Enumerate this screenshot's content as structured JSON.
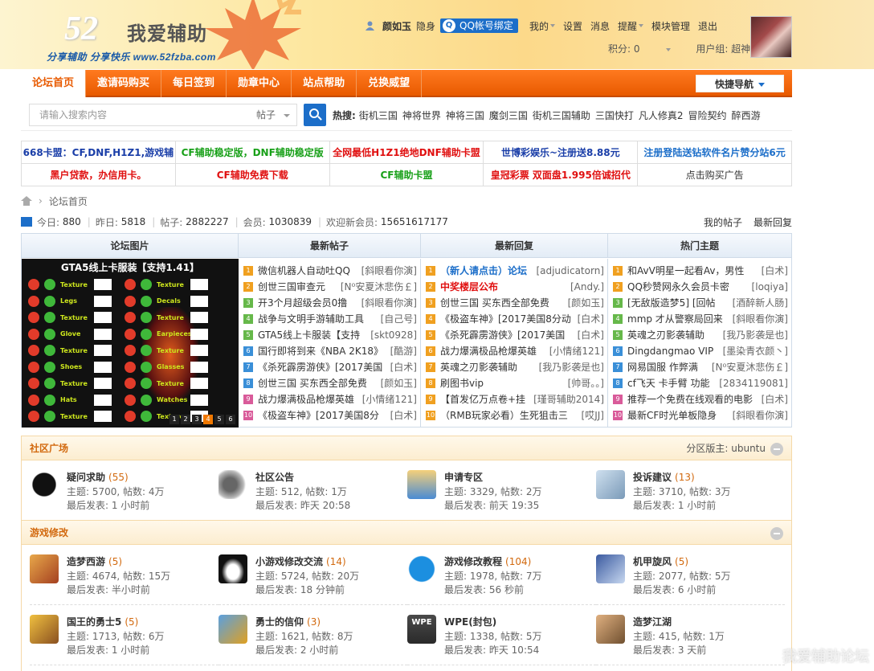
{
  "header": {
    "logo_num": "52",
    "logo_text": "我爱辅助",
    "slogan": "分享辅助  分享快乐  www.52fzba.com",
    "username": "颜如玉",
    "status": "隐身",
    "qq_bind": "QQ帐号绑定",
    "nav_links": [
      "我的",
      "设置",
      "消息",
      "提醒",
      "模块管理",
      "退出"
    ],
    "points": "积分: 0",
    "group": "用户组: 超神"
  },
  "main_nav": {
    "tabs": [
      "论坛首页",
      "邀请码购买",
      "每日签到",
      "勋章中心",
      "站点帮助",
      "兑换威望"
    ],
    "quick_nav": "快捷导航"
  },
  "search": {
    "placeholder": "请输入搜索内容",
    "type": "帖子",
    "hot_label": "热搜:",
    "hot_items": [
      "街机三国",
      "神将世界",
      "神将三国",
      "魔剑三国",
      "街机三国辅助",
      "三国快打",
      "凡人修真2",
      "冒险契约",
      "醉西游"
    ]
  },
  "ads": [
    [
      {
        "text": "668卡盟：CF,DNF,H1Z1,游戏辅",
        "color": "#1a3ea8"
      },
      {
        "text": "CF辅助稳定版，DNF辅助稳定版",
        "color": "#18a018"
      },
      {
        "text": "全网最低H1Z1绝地DNF辅助卡盟",
        "color": "#e01010"
      },
      {
        "text": "世博彩娱乐~注册送8.88元",
        "color": "#1a3ea8"
      },
      {
        "text": "注册登陆送钻软件名片赞分站6元",
        "color": "#1c6ec9"
      }
    ],
    [
      {
        "text": "黑户贷款，办信用卡。",
        "color": "#e01010"
      },
      {
        "text": "CF辅助免费下载",
        "color": "#e01010"
      },
      {
        "text": "CF辅助卡盟",
        "color": "#18a018"
      },
      {
        "text": "皇冠彩票 双面盘1.995倍诚招代",
        "color": "#e01010"
      },
      {
        "text": "点击购买广告",
        "color": "#333333"
      }
    ]
  ],
  "breadcrumb": {
    "item": "论坛首页"
  },
  "stats": {
    "today_label": "今日:",
    "today": "880",
    "yesterday_label": "昨日:",
    "yesterday": "5818",
    "posts_label": "帖子:",
    "posts": "2882227",
    "members_label": "会员:",
    "members": "1030839",
    "welcome_label": "欢迎新会员:",
    "newest": "15651617177",
    "my_posts": "我的帖子",
    "latest_reply": "最新回复"
  },
  "portal": {
    "headers": [
      "论坛图片",
      "最新帖子",
      "最新回复",
      "热门主题"
    ],
    "pic_caption": "GTA5线上卡服装【支持1.41】",
    "pic_labels": [
      "Texture",
      "Legs",
      "Texture",
      "Glove",
      "Texture",
      "Shoes",
      "Texture",
      "Hats",
      "Texture"
    ],
    "pic_labels2": [
      "Texture",
      "Decals",
      "Texture",
      "Earpieces",
      "Texture",
      "Glasses",
      "Texture",
      "Watches",
      "Texture"
    ],
    "pic_pages": [
      "1",
      "2",
      "3",
      "4",
      "5",
      "6"
    ],
    "latest_posts": [
      {
        "title": "微信机器人自动吐QQ",
        "author": "[斜眼看你演]"
      },
      {
        "title": "创世三国审查元",
        "author": "[N⁰安夏沐悲伤￡]"
      },
      {
        "title": "开3个月超级会员0撸",
        "author": "[斜眼看你演]"
      },
      {
        "title": "战争与文明手游辅助工具",
        "author": "[自己号]"
      },
      {
        "title": "GTA5线上卡服装【支持",
        "author": "[skt0928]"
      },
      {
        "title": "国行即将到来《NBA 2K18》",
        "author": "[酷游]"
      },
      {
        "title": "《杀死霹雳游侠》[2017美国",
        "author": "[白术]"
      },
      {
        "title": "创世三国 买东西全部免费",
        "author": "[颜如玉]"
      },
      {
        "title": "战力爆满极品枪爆英雄",
        "author": "[小情绪121]"
      },
      {
        "title": "《极盗车神》[2017美国8分",
        "author": "[白术]"
      }
    ],
    "latest_replies": [
      {
        "title": "（新人请点击）论坛",
        "author": "[adjudicatorn]",
        "color": "#1c6ec9"
      },
      {
        "title": "中奖楼层公布",
        "author": "[Andy.]",
        "color": "#e01010"
      },
      {
        "title": "创世三国 买东西全部免费",
        "author": "[颜如玉]",
        "color": "#333333"
      },
      {
        "title": "《极盗车神》[2017美国8分动",
        "author": "[白术]",
        "color": "#333333"
      },
      {
        "title": "《杀死霹雳游侠》[2017美国",
        "author": "[白术]",
        "color": "#333333"
      },
      {
        "title": "战力爆满极品枪爆英雄",
        "author": "[小情绪121]",
        "color": "#333333"
      },
      {
        "title": "英魂之刃影袭辅助",
        "author": "[我乃影袭是也]",
        "color": "#333333"
      },
      {
        "title": "刷图书vip",
        "author": "[帅哥。。]",
        "color": "#333333"
      },
      {
        "title": "【首发亿万点卷+挂",
        "author": "[瑾哥辅助2014]",
        "color": "#333333"
      },
      {
        "title": "（RMB玩家必看）生死狙击三",
        "author": "[哎JJ]",
        "color": "#333333"
      }
    ],
    "hot_topics": [
      {
        "title": "和AvV明星一起看Av，男性",
        "author": "[白术]"
      },
      {
        "title": "QQ秒赞网永久会员卡密",
        "author": "[loqiya]"
      },
      {
        "title": "[无敌版造梦5] [回帖",
        "author": "[酒醉新人肠]"
      },
      {
        "title": "mmp 才从警察局回来",
        "author": "[斜眼看你演]"
      },
      {
        "title": "英魂之刃影袭辅助",
        "author": "[我乃影袭是也]"
      },
      {
        "title": "Dingdangmao VIP",
        "author": "[墨染青衣颜丶]"
      },
      {
        "title": "网易国服 作弊满",
        "author": "[N⁰安夏沐悲伤￡]"
      },
      {
        "title": "cf飞天 卡手臂 功能",
        "author": "[2834119081]"
      },
      {
        "title": "推荐一个免费在线观看的电影",
        "author": "[白术]"
      },
      {
        "title": "最新CF时光单板隐身",
        "author": "[斜眼看你演]"
      }
    ]
  },
  "community": {
    "title": "社区广场",
    "moderator": "分区版主: ubuntu",
    "forums": [
      {
        "name": "疑问求助",
        "count": "(55)",
        "stats": "主题: 5700, 帖数: 4万",
        "last": "最后发表: 1 小时前",
        "icon": "soot-sprite-icon"
      },
      {
        "name": "社区公告",
        "count": "",
        "stats": "主题: 512, 帖数: 1万",
        "last": "最后发表: 昨天 20:58",
        "icon": "speaker-icon"
      },
      {
        "name": "申请专区",
        "count": "",
        "stats": "主题: 3329, 帖数: 2万",
        "last": "最后发表: 前天 19:35",
        "icon": "student-icon"
      },
      {
        "name": "投诉建议",
        "count": "(13)",
        "stats": "主题: 3710, 帖数: 3万",
        "last": "最后发表: 1 小时前",
        "icon": "envelope-icon"
      }
    ]
  },
  "gamemod": {
    "title": "游戏修改",
    "forums": [
      {
        "name": "造梦西游",
        "count": "(5)",
        "stats": "主题: 4674, 帖数: 15万",
        "last": "最后发表: 半小时前",
        "icon": "game-cover-icon"
      },
      {
        "name": "小游戏修改交流",
        "count": "(14)",
        "stats": "主题: 5724, 帖数: 20万",
        "last": "最后发表: 18 分钟前",
        "icon": "penguin-icon"
      },
      {
        "name": "游戏修改教程",
        "count": "(104)",
        "stats": "主题: 1978, 帖数: 7万",
        "last": "最后发表: 56 秒前",
        "icon": "skype-icon"
      },
      {
        "name": "机甲旋风",
        "count": "(5)",
        "stats": "主题: 2077, 帖数: 5万",
        "last": "最后发表: 6 小时前",
        "icon": "mecha-icon"
      },
      {
        "name": "国王的勇士5",
        "count": "(5)",
        "stats": "主题: 1713, 帖数: 6万",
        "last": "最后发表: 1 小时前",
        "icon": "king-icon"
      },
      {
        "name": "勇士的信仰",
        "count": "(3)",
        "stats": "主题: 1621, 帖数: 8万",
        "last": "最后发表: 2 小时前",
        "icon": "warrior-icon"
      },
      {
        "name": "WPE(封包)",
        "count": "",
        "stats": "主题: 1338, 帖数: 5万",
        "last": "最后发表: 昨天 10:54",
        "icon": "wpe-icon"
      },
      {
        "name": "造梦江湖",
        "count": "",
        "stats": "主题: 415, 帖数: 1万",
        "last": "最后发表: 3 天前",
        "icon": "jianghu-icon"
      }
    ]
  },
  "watermark": "我爱辅助论坛"
}
